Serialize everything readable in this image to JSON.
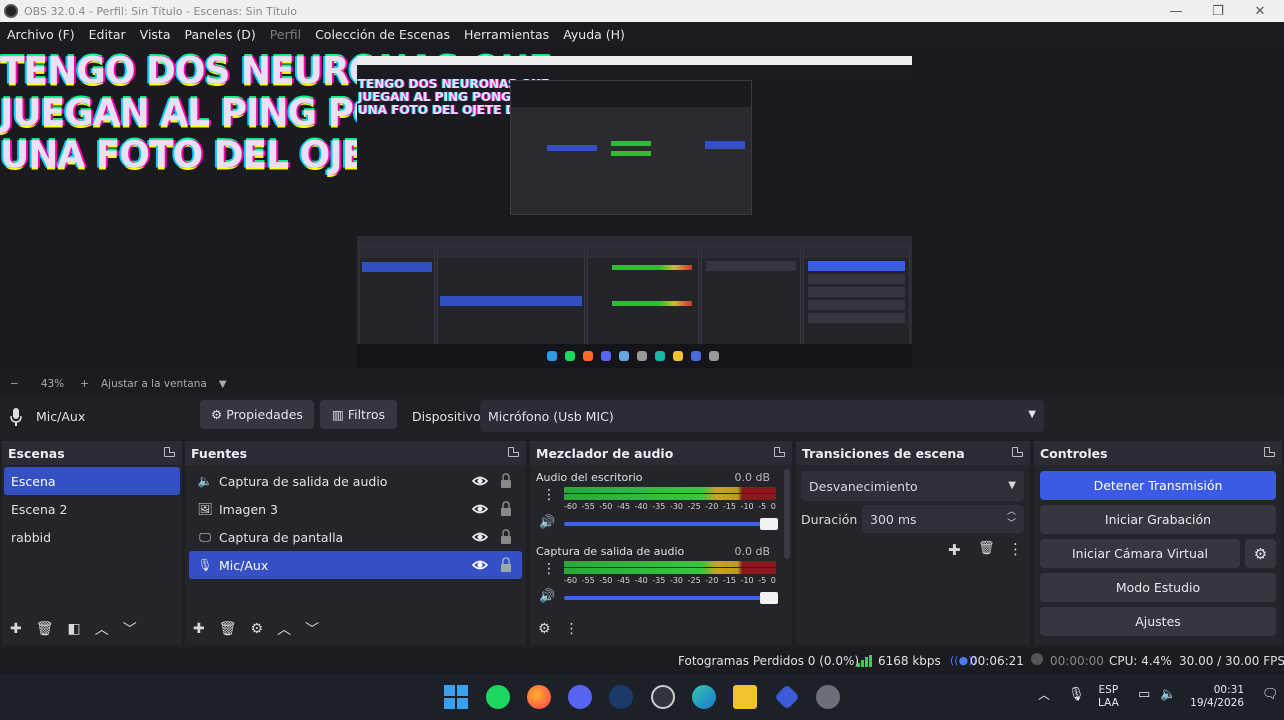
{
  "window": {
    "title": "OBS 32.0.4 - Perfil: Sin Título - Escenas: Sin Título",
    "controls": [
      "—",
      "❐",
      "✕"
    ]
  },
  "menu": [
    "Archivo (F)",
    "Editar",
    "Vista",
    "Paneles (D)",
    "Perfil",
    "Colección de Escenas",
    "Herramientas",
    "Ayuda (H)"
  ],
  "preview": {
    "meme_lines": [
      "TENGO DOS NEURONAS QUE",
      "JUEGAN AL PING PONG CON",
      "UNA FOTO DEL OJETE DE LANATA"
    ]
  },
  "zoom": {
    "minus": "−",
    "level": "43%",
    "plus": "+",
    "fit": "Ajustar a la ventana"
  },
  "source_toolbar": {
    "source_name": "Mic/Aux",
    "properties": "Propiedades",
    "filters": "Filtros",
    "device_label": "Dispositivo",
    "device_value": "Micrófono (Usb MIC)"
  },
  "scenes": {
    "title": "Escenas",
    "items": [
      "Escena",
      "Escena 2",
      "rabbid"
    ]
  },
  "sources": {
    "title": "Fuentes",
    "items": [
      {
        "label": "Captura de salida de audio",
        "icon": "speaker-icon"
      },
      {
        "label": "Imagen 3",
        "icon": "image-icon"
      },
      {
        "label": "Captura de pantalla",
        "icon": "monitor-icon"
      },
      {
        "label": "Mic/Aux",
        "icon": "microphone-icon"
      }
    ]
  },
  "mixer": {
    "title": "Mezclador de audio",
    "channels": [
      {
        "name": "Audio del escritorio",
        "db": "0.0 dB",
        "volume": 1.0
      },
      {
        "name": "Captura de salida de audio",
        "db": "0.0 dB",
        "volume": 1.0
      }
    ],
    "scale": [
      "-60",
      "-55",
      "-50",
      "-45",
      "-40",
      "-35",
      "-30",
      "-25",
      "-20",
      "-15",
      "-10",
      "-5",
      "0"
    ]
  },
  "transitions": {
    "title": "Transiciones de escena",
    "selected": "Desvanecimiento",
    "duration_label": "Duración",
    "duration_value": "300 ms"
  },
  "controls": {
    "title": "Controles",
    "stop_stream": "Detener Transmisión",
    "start_recording": "Iniciar Grabación",
    "start_virtual_cam": "Iniciar Cámara Virtual",
    "studio_mode": "Modo Estudio",
    "settings": "Ajustes"
  },
  "status": {
    "dropped_frames": "Fotogramas Perdidos 0 (0.0%)",
    "bitrate": "6168 kbps",
    "stream_time": "00:06:21",
    "record_time": "00:00:00",
    "cpu": "CPU: 4.4%",
    "fps": "30.00 / 30.00 FPS"
  },
  "taskbar": {
    "lang_top": "ESP",
    "lang_bottom": "LAA",
    "time": "00:31",
    "date": "19/4/2026"
  },
  "colors": {
    "accent": "#3550c4",
    "stop_button": "#3b5be6",
    "meter_green": "#39c642",
    "meter_yellow": "#c9a12a",
    "meter_red": "#8a1a1a"
  }
}
